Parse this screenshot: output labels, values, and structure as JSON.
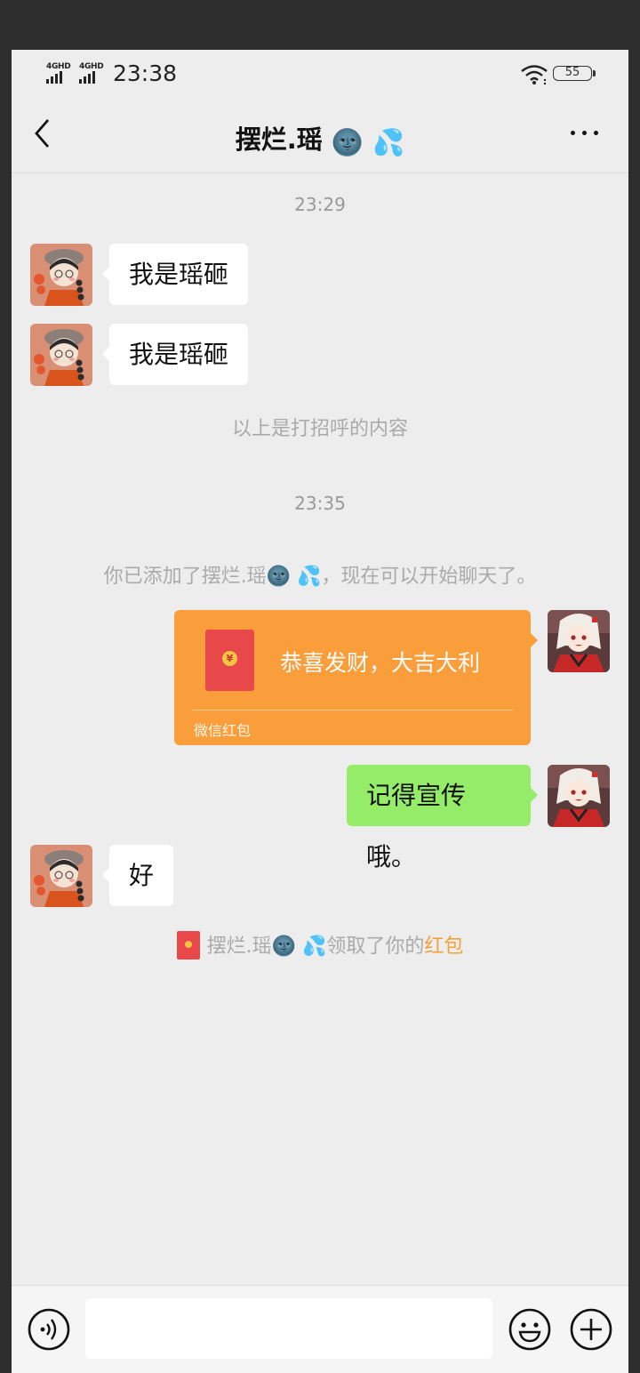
{
  "status_bar": {
    "network1": "4GHD",
    "network2": "4GHD",
    "time": "23:38",
    "battery": "55"
  },
  "header": {
    "title": "摆烂.瑶",
    "title_emoji": "🌚 💦"
  },
  "messages": {
    "time1": "23:29",
    "m1": "我是瑶砸",
    "m2": "我是瑶砸",
    "greeting_note": "以上是打招呼的内容",
    "time2": "23:35",
    "added_note_prefix": "你已添加了摆烂.瑶",
    "added_note_emoji": "🌚 💦",
    "added_note_suffix": "，现在可以开始聊天了。",
    "red_packet": {
      "text": "恭喜发财，大吉大利",
      "label": "微信红包",
      "coin": "¥"
    },
    "m3": "记得宣传哦。",
    "m4": "好",
    "claim_name": "摆烂.瑶",
    "claim_emoji": "🌚 💦",
    "claim_text": "领取了你的",
    "claim_link": "红包"
  },
  "input_bar": {
    "value": "",
    "placeholder": ""
  },
  "icons": {
    "back": "chevron-left-icon",
    "more": "more-dots-icon",
    "voice": "voice-icon",
    "emoji": "emoji-icon",
    "plus": "plus-icon"
  },
  "colors": {
    "self_bubble": "#95ec69",
    "red_packet": "#f99e3b",
    "link": "#f3a03c"
  }
}
